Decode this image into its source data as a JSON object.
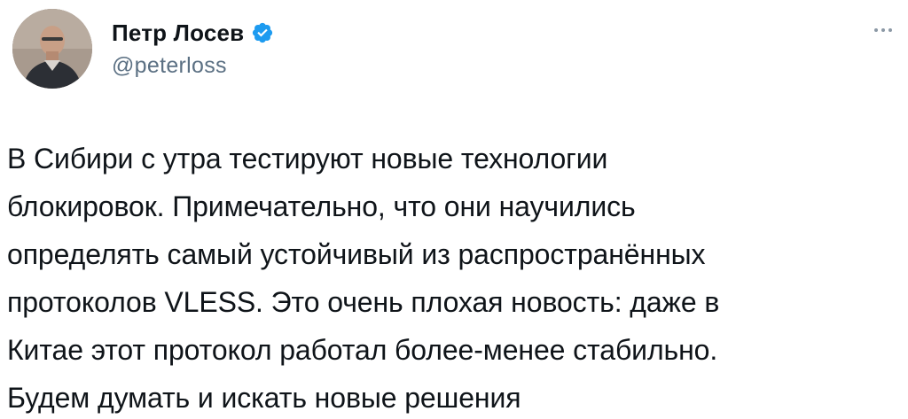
{
  "author": {
    "display_name": "Петр Лосев",
    "handle": "@peterloss",
    "verified": true,
    "verified_badge_color": "#1d9bf0"
  },
  "icons": {
    "verified": "verified-badge-icon",
    "more": "more-horizontal-icon"
  },
  "tweet": {
    "lines": [
      "В Сибири с утра тестируют новые технологии",
      "блокировок. Примечательно, что они научились",
      "определять самый устойчивый из распространённых",
      "протоколов VLESS. Это очень плохая новость: даже в",
      "Китае этот протокол работал более-менее стабильно.",
      "Будем думать и искать новые решения"
    ]
  },
  "colors": {
    "text": "#0f1419",
    "secondary": "#5b7083",
    "background": "#ffffff"
  }
}
